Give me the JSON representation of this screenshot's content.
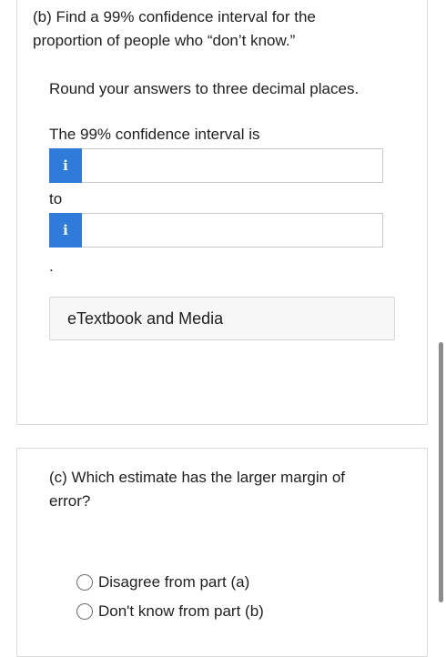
{
  "part_b": {
    "question": "(b) Find a 99% confidence interval for the proportion of people who “don’t know.”",
    "question_line1": "(b) Find a 99% confidence interval for the",
    "question_line2": "proportion of people who “don’t know.”",
    "instruction": "Round your answers to three decimal places.",
    "interval_label": "The 99% confidence interval is",
    "lower_input": {
      "value": "",
      "placeholder": "",
      "icon": "i"
    },
    "to_label": "to",
    "upper_input": {
      "value": "",
      "placeholder": "",
      "icon": "i"
    },
    "period": ".",
    "etextbook_button": "eTextbook and Media"
  },
  "part_c": {
    "question_line1": "(c) Which estimate has the larger margin of",
    "question_line2": "error?",
    "options": [
      {
        "label": "Disagree from part (a)",
        "selected": false
      },
      {
        "label": "Don't know from part (b)",
        "selected": false
      }
    ]
  },
  "colors": {
    "info_button": "#2e7bd9",
    "border": "#d9d9d9",
    "text": "#1f1f1f"
  }
}
